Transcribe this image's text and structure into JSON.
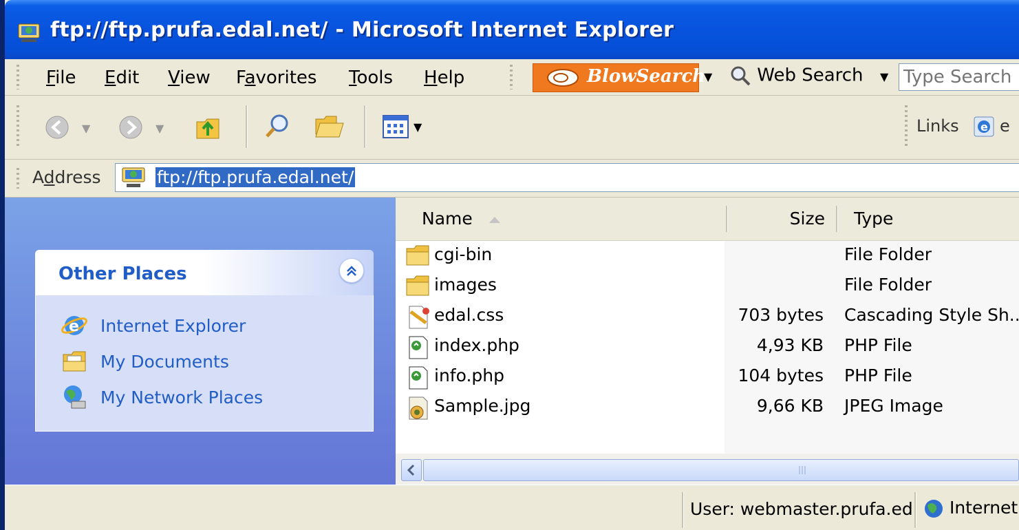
{
  "window": {
    "title": "ftp://ftp.prufa.edal.net/ - Microsoft Internet Explorer"
  },
  "menubar": {
    "items": [
      {
        "label": "File",
        "u": "F",
        "rest": "ile"
      },
      {
        "label": "Edit",
        "u": "E",
        "rest": "dit"
      },
      {
        "label": "View",
        "u": "V",
        "rest": "iew"
      },
      {
        "label": "Favorites",
        "pre": "F",
        "u": "a",
        "rest": "vorites"
      },
      {
        "label": "Tools",
        "u": "T",
        "rest": "ools"
      },
      {
        "label": "Help",
        "u": "H",
        "rest": "elp"
      }
    ],
    "blowsearch_label": "BlowSearch",
    "web_search_label": "Web Search",
    "search_placeholder": "Type Search"
  },
  "toolbar": {
    "links_label": "Links",
    "links_trailing": "e"
  },
  "address": {
    "label_pre": "A",
    "label_u": "d",
    "label_rest": "dress",
    "value": "ftp://ftp.prufa.edal.net/"
  },
  "sidebar": {
    "title": "Other Places",
    "items": [
      {
        "label": "Internet Explorer",
        "icon": "internet-explorer-icon"
      },
      {
        "label": "My Documents",
        "icon": "my-documents-icon"
      },
      {
        "label": "My Network Places",
        "icon": "network-places-icon"
      }
    ]
  },
  "filelist": {
    "columns": {
      "name": "Name",
      "size": "Size",
      "type": "Type"
    },
    "rows": [
      {
        "name": "cgi-bin",
        "size": "",
        "type": "File Folder",
        "icon": "folder-icon"
      },
      {
        "name": "images",
        "size": "",
        "type": "File Folder",
        "icon": "folder-icon"
      },
      {
        "name": "edal.css",
        "size": "703 bytes",
        "type": "Cascading Style Sh...",
        "icon": "css-file-icon"
      },
      {
        "name": "index.php",
        "size": "4,93 KB",
        "type": "PHP File",
        "icon": "php-file-icon"
      },
      {
        "name": "info.php",
        "size": "104 bytes",
        "type": "PHP File",
        "icon": "php-file-icon"
      },
      {
        "name": "Sample.jpg",
        "size": "9,66 KB",
        "type": "JPEG Image",
        "icon": "jpeg-file-icon"
      }
    ]
  },
  "statusbar": {
    "user": "User: webmaster.prufa.edal.net",
    "zone": "Internet"
  },
  "colors": {
    "title_bar": "#0853dd",
    "sidebar_link": "#215dc6",
    "selection": "#316ac5",
    "blowsearch": "#f0781e"
  }
}
